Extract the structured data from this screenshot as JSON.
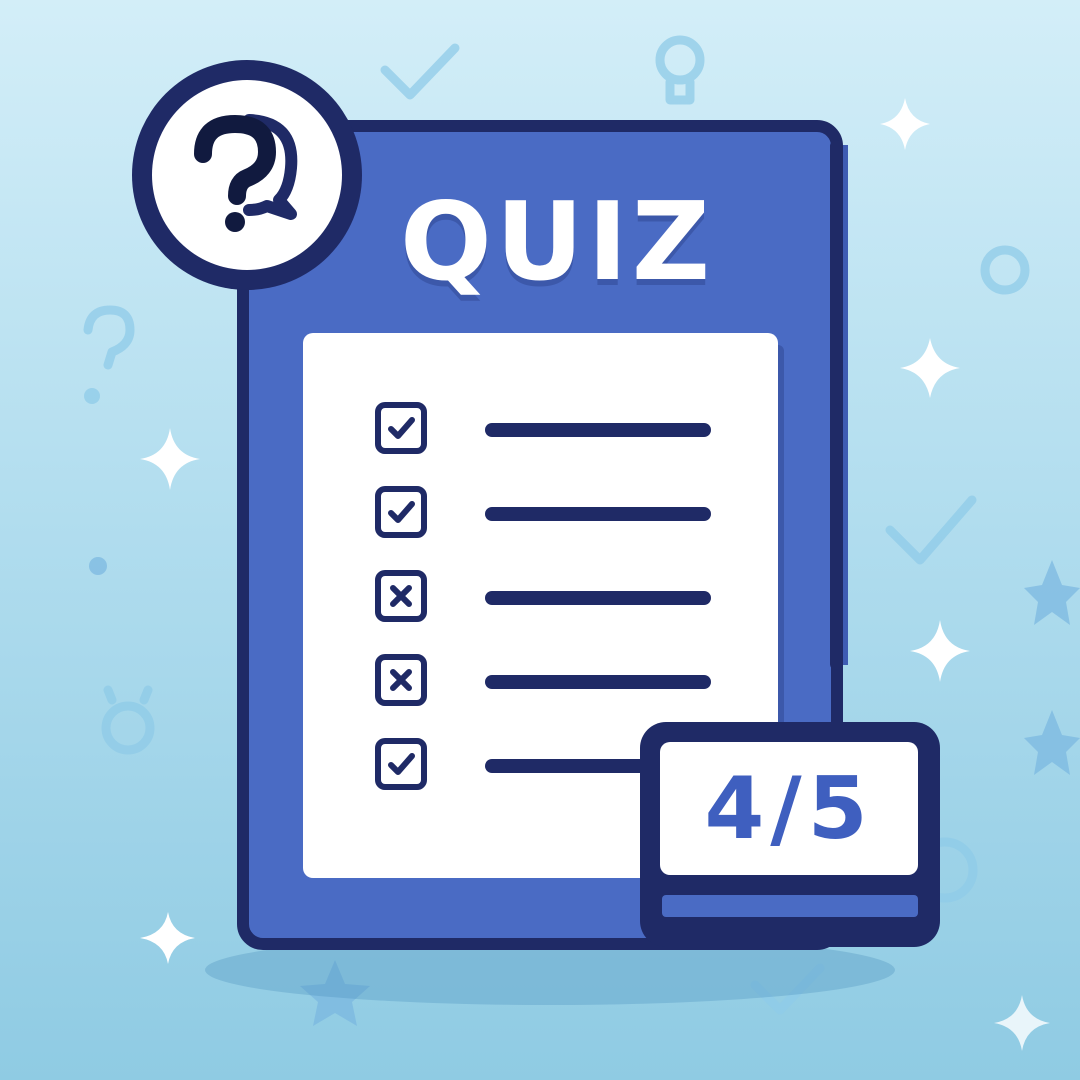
{
  "quiz": {
    "title": "QUIZ",
    "score": {
      "correct": 4,
      "total": 5,
      "label": "4/5"
    },
    "questions": [
      {
        "result": "correct",
        "mark": "check-icon"
      },
      {
        "result": "correct",
        "mark": "check-icon"
      },
      {
        "result": "incorrect",
        "mark": "cross-icon"
      },
      {
        "result": "incorrect",
        "mark": "cross-icon"
      },
      {
        "result": "correct",
        "mark": "check-icon"
      }
    ]
  },
  "badge": {
    "icon": "question-chat-icon"
  },
  "colors": {
    "background_top": "#d3eef8",
    "background_bottom": "#8fcbe3",
    "card": "#4a6bc4",
    "outline": "#1f2a66",
    "paper": "#ffffff",
    "score_text": "#3f5fbf"
  }
}
